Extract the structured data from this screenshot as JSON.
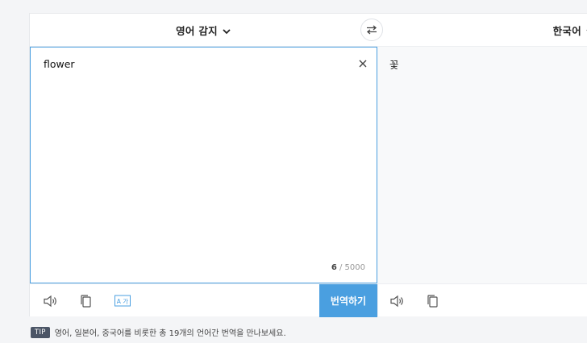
{
  "lang_bar": {
    "source_language": "영어 감지",
    "target_language": "한국어"
  },
  "source": {
    "text": "flower",
    "counter_current": "6",
    "counter_max": " / 5000"
  },
  "target": {
    "text": "꽃"
  },
  "toolbar": {
    "translate_label": "번역하기",
    "font_size_icon_label": "A 가"
  },
  "tip": {
    "badge": "TIP",
    "text": "영어, 일본어, 중국어를 비롯한 총 19개의 언어간 번역을 만나보세요."
  },
  "colors": {
    "accent": "#4a9fe0",
    "badge_bg": "#4b5566"
  }
}
